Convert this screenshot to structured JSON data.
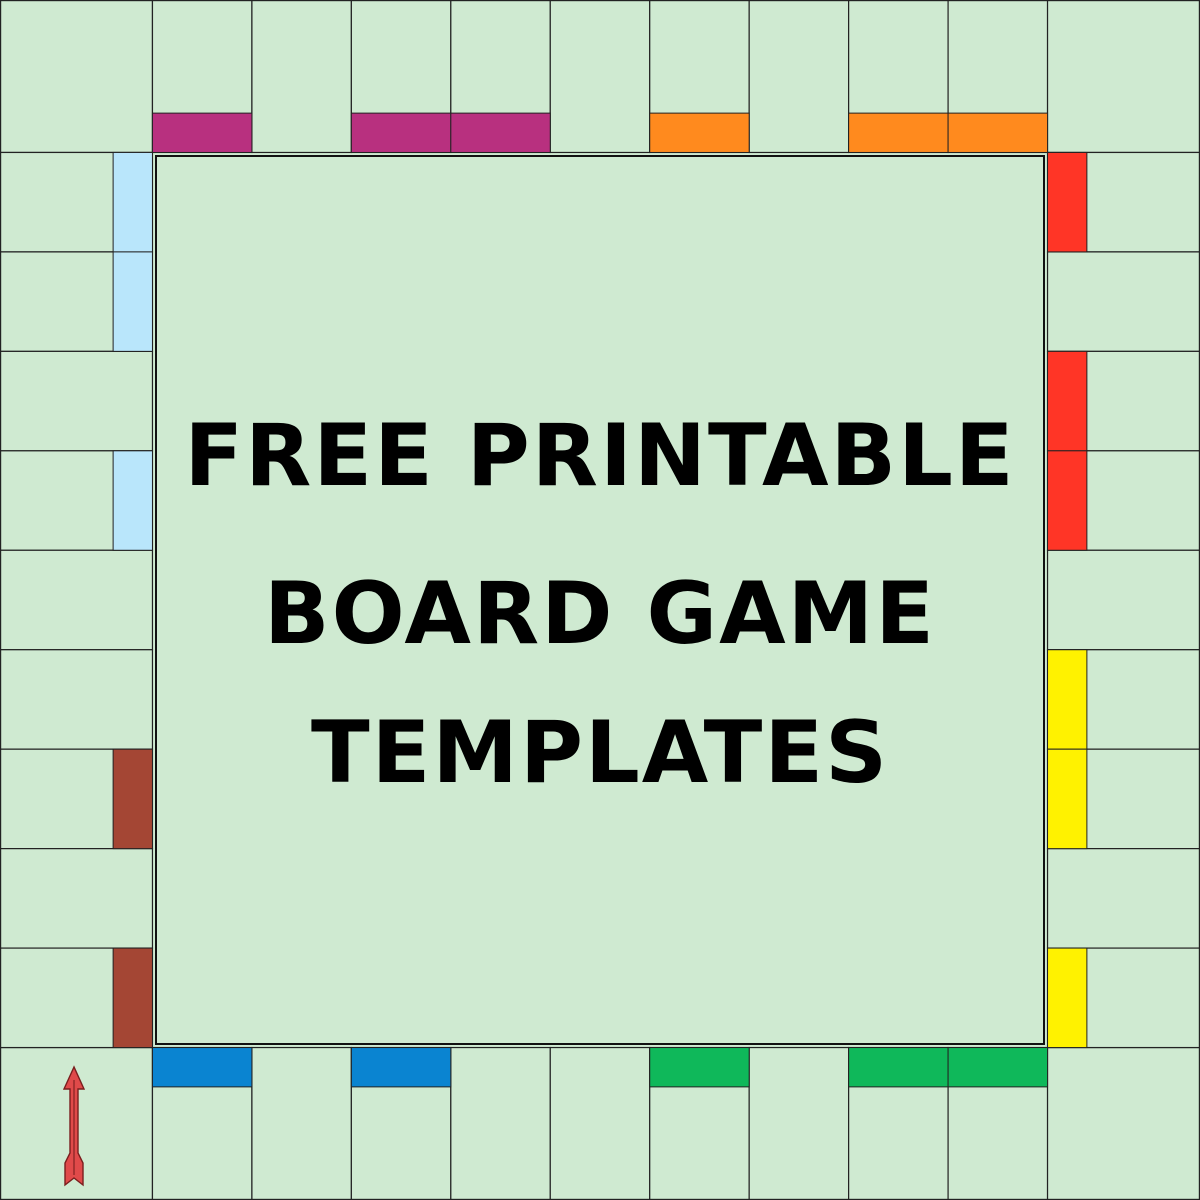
{
  "title": {
    "lines": [
      "FREE PRINTABLE",
      "BOARD GAME",
      "TEMPLATES"
    ]
  },
  "colors": {
    "background": "#cfead1",
    "line": "#222222",
    "arrow": "#e04a4a"
  },
  "board": {
    "top": [
      {
        "band": null
      },
      {
        "band": "#b8307f"
      },
      {
        "band": null
      },
      {
        "band": "#b8307f"
      },
      {
        "band": "#b8307f"
      },
      {
        "band": null
      },
      {
        "band": "#ff8a1e"
      },
      {
        "band": null
      },
      {
        "band": "#ff8a1e"
      },
      {
        "band": "#ff8a1e"
      },
      {
        "band": null
      }
    ],
    "left": [
      {
        "band": null
      },
      {
        "band": "#b9e6fb"
      },
      {
        "band": "#b9e6fb"
      },
      {
        "band": null
      },
      {
        "band": "#b9e6fb"
      },
      {
        "band": null
      },
      {
        "band": null
      },
      {
        "band": "#a44634"
      },
      {
        "band": null
      },
      {
        "band": "#a44634"
      },
      {
        "band": null
      }
    ],
    "right": [
      {
        "band": null
      },
      {
        "band": "#ff3526"
      },
      {
        "band": null
      },
      {
        "band": "#ff3526"
      },
      {
        "band": "#ff3526"
      },
      {
        "band": null
      },
      {
        "band": "#fff200"
      },
      {
        "band": "#fff200"
      },
      {
        "band": null
      },
      {
        "band": "#fff200"
      },
      {
        "band": null
      }
    ],
    "bottom": [
      {
        "band": null
      },
      {
        "band": "#0a84d1"
      },
      {
        "band": null
      },
      {
        "band": "#0a84d1"
      },
      {
        "band": null
      },
      {
        "band": null
      },
      {
        "band": "#0fb85a"
      },
      {
        "band": null
      },
      {
        "band": "#0fb85a"
      },
      {
        "band": "#0fb85a"
      },
      {
        "band": null
      }
    ],
    "start_arrow": {
      "icon": "arrow-up-icon",
      "color": "#e04a4a"
    }
  }
}
